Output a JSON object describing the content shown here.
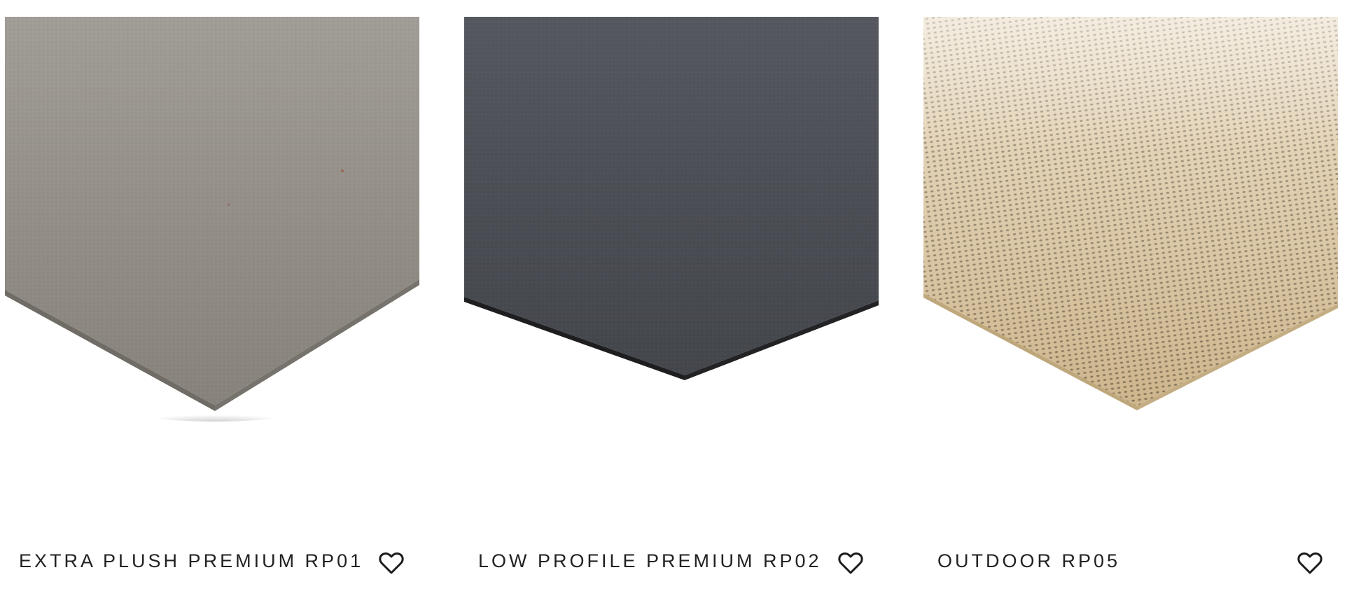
{
  "products": [
    {
      "title": "EXTRA PLUSH PREMIUM RP01",
      "swatch": "gray felt",
      "colors": {
        "top": "#9a968f",
        "mid": "#8d8881",
        "edge": "#6e6a64"
      }
    },
    {
      "title": "LOW PROFILE PREMIUM RP02",
      "swatch": "charcoal felt",
      "colors": {
        "top": "#50535a",
        "mid": "#45484e",
        "edge": "#1c1c1f"
      }
    },
    {
      "title": "OUTDOOR RP05",
      "swatch": "beige mesh",
      "colors": {
        "top": "#e2cfae",
        "mid": "#d4bd96",
        "edge": "#3a3023"
      }
    }
  ],
  "icons": {
    "favorite": "heart-outline-icon"
  }
}
